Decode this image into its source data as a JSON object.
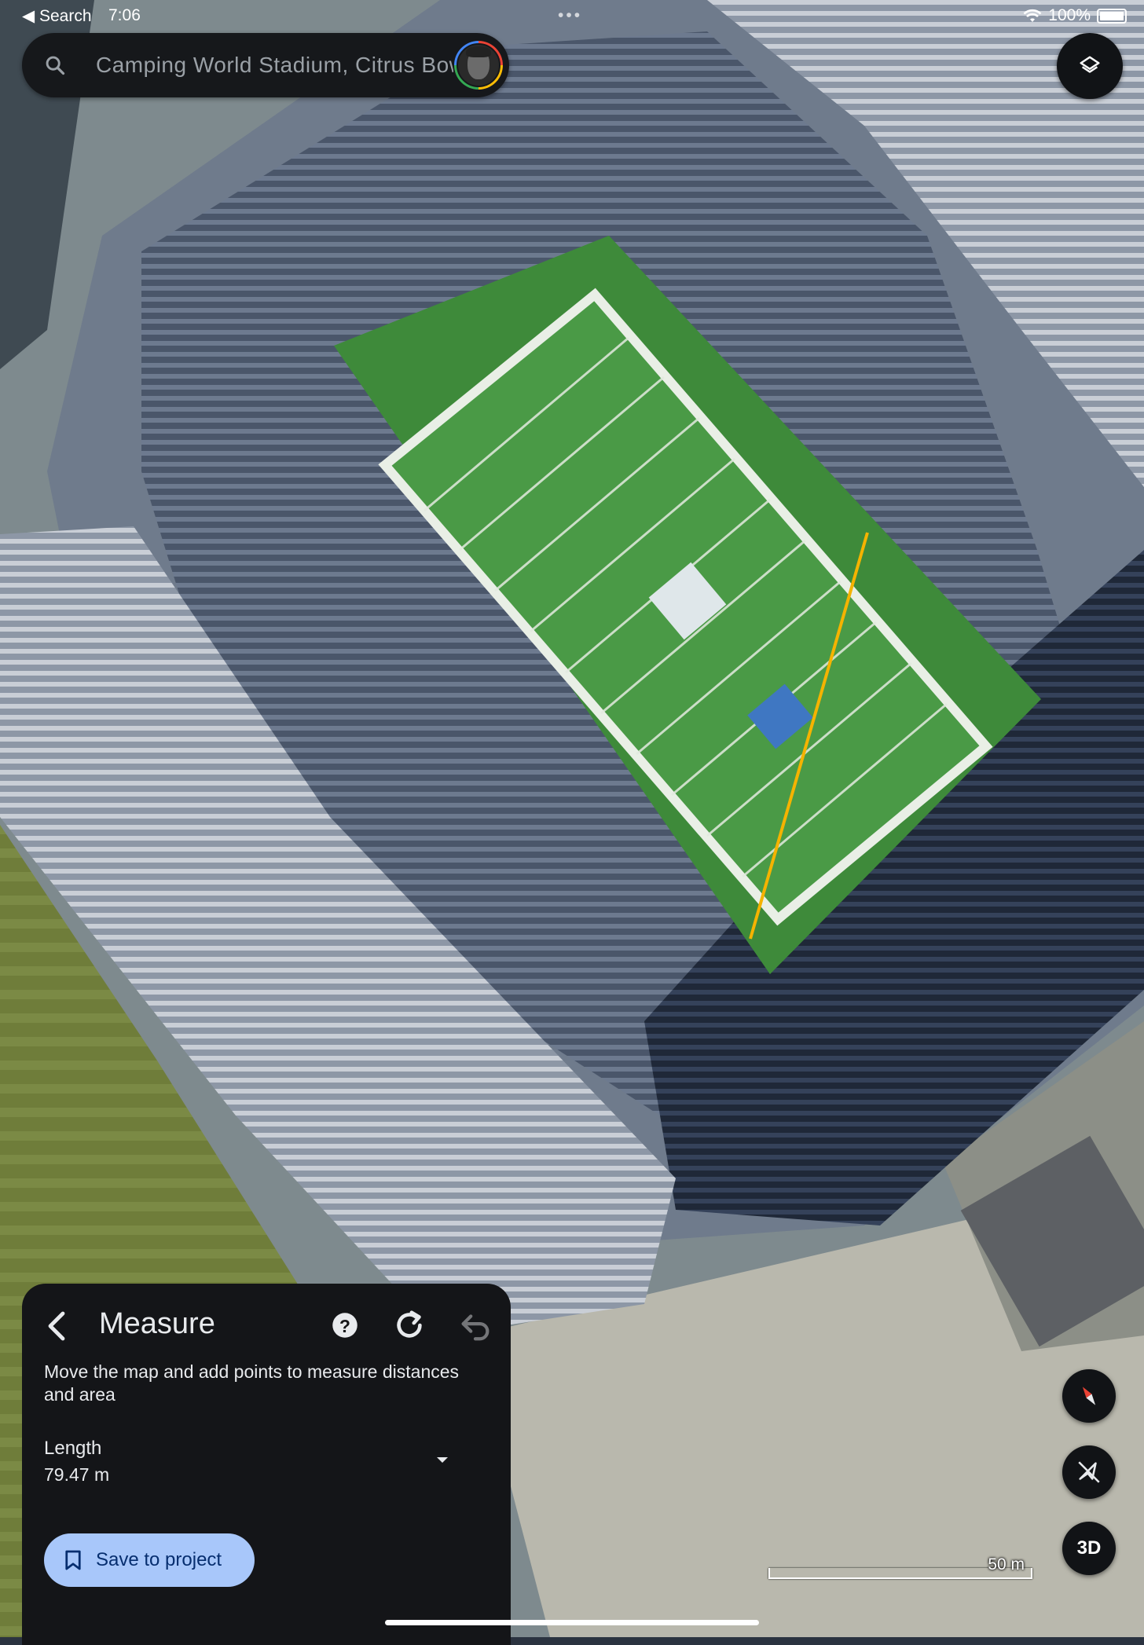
{
  "status_bar": {
    "back_label": "◀ Search",
    "time": "7:06",
    "battery": "100%"
  },
  "search": {
    "value": "Camping World Stadium, Citrus Bowl",
    "icon": "search-icon"
  },
  "map": {
    "type": "satellite",
    "place": "Camping World Stadium",
    "measure_line_color": "#f5b301"
  },
  "controls": {
    "layers_icon": "layers-icon",
    "compass_icon": "compass-icon",
    "tilt_icon": "tilt-off-icon",
    "view_mode": "3D"
  },
  "scale": {
    "label": "50 m"
  },
  "measure_panel": {
    "title": "Measure",
    "description": "Move the map and add points to measure distances and area",
    "length_label": "Length",
    "length_value": "79.47 m",
    "save_label": "Save to project",
    "accent": "#a8c7fa"
  }
}
